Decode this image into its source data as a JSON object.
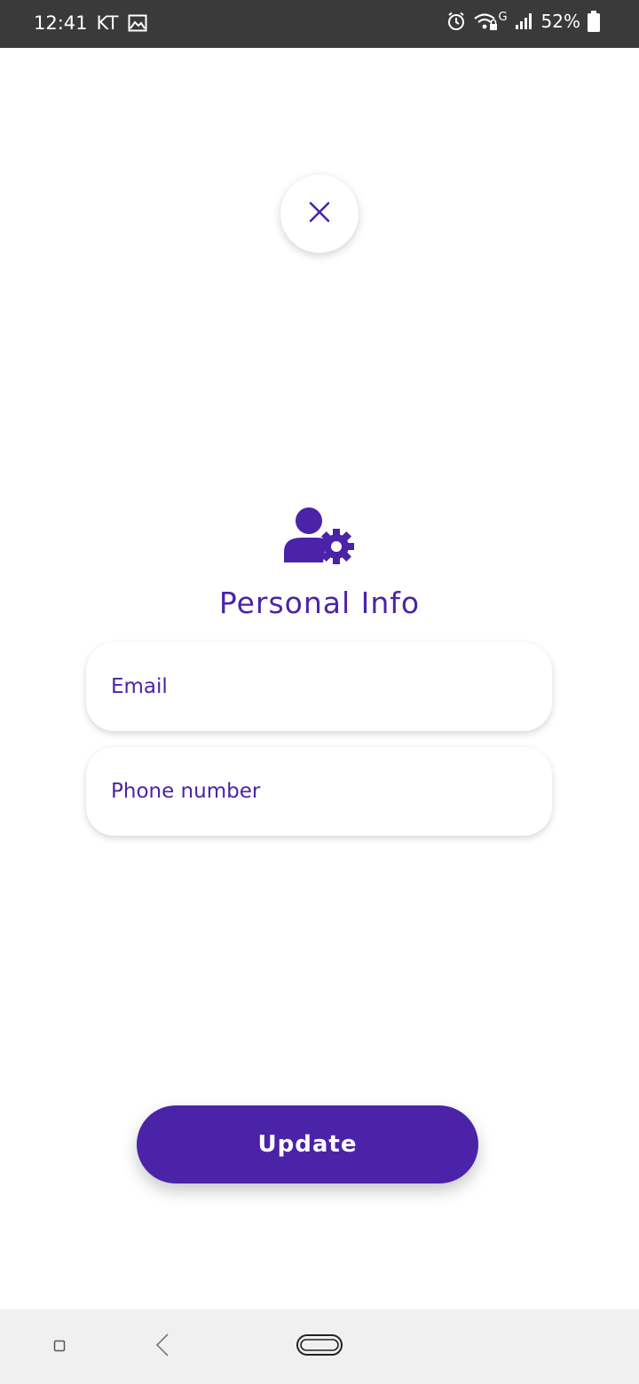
{
  "status_bar": {
    "time": "12:41",
    "carrier": "KT",
    "network_label": "G",
    "battery_percent": "52%",
    "icons": [
      "image-icon",
      "alarm-icon",
      "wifi-icon",
      "signal-icon",
      "battery-icon"
    ]
  },
  "close_button": {
    "icon": "close-icon"
  },
  "header": {
    "icon": "user-settings-icon",
    "title": "Personal Info"
  },
  "form": {
    "email": {
      "value": "",
      "placeholder": "Email"
    },
    "phone": {
      "value": "",
      "placeholder": "Phone number"
    }
  },
  "update_button": {
    "label": "Update"
  },
  "nav_bar": {
    "icons": [
      "recent-apps-icon",
      "back-icon",
      "home-icon"
    ]
  },
  "colors": {
    "accent": "#4b23a8",
    "status_bar_bg": "#3a3a3a",
    "nav_bar_bg": "#f0f0f0",
    "background": "#ffffff"
  }
}
